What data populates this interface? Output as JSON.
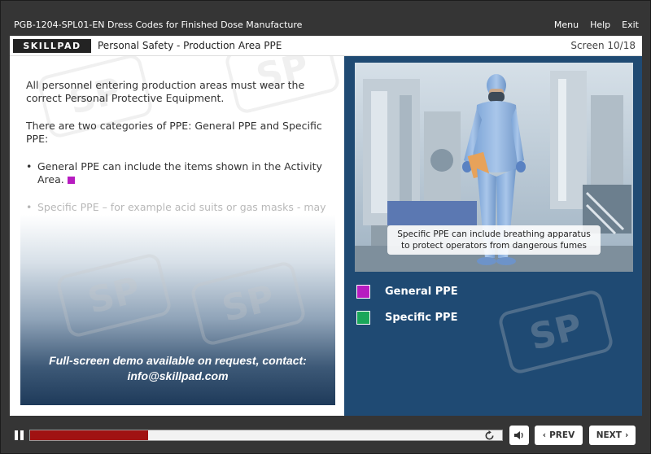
{
  "course": {
    "title": "PGB-1204-SPL01-EN Dress Codes for Finished Dose Manufacture",
    "nav": [
      "Menu",
      "Help",
      "Exit"
    ]
  },
  "header": {
    "logo": "SKILLPAD",
    "screen_title": "Personal Safety - Production Area PPE",
    "screen_counter": "Screen 10/18"
  },
  "content": {
    "intro": "All personnel entering production areas must wear the correct Personal Protective Equipment.",
    "categories_text": "There are two categories of PPE: General PPE and Specific PPE:",
    "bullets": [
      {
        "text": "General PPE can include the items shown in the Activity Area.",
        "color": "#b71cc0"
      },
      {
        "text": "Specific PPE – for example acid suits or gas masks - may be required for specialized tasks such as handling of acids.",
        "color": "#1aa75a"
      }
    ],
    "demo_line1": "Full-screen demo available on request, contact:",
    "demo_line2": "info@skillpad.com",
    "watermark": "SP"
  },
  "activity": {
    "caption": "Specific PPE can include breathing apparatus to protect operators from dangerous fumes",
    "categories": [
      {
        "label": "General PPE",
        "color": "#b71cc0"
      },
      {
        "label": "Specific PPE",
        "color": "#1aa75a"
      }
    ]
  },
  "controls": {
    "progress": 0.25,
    "prev_label": "PREV",
    "next_label": "NEXT"
  }
}
